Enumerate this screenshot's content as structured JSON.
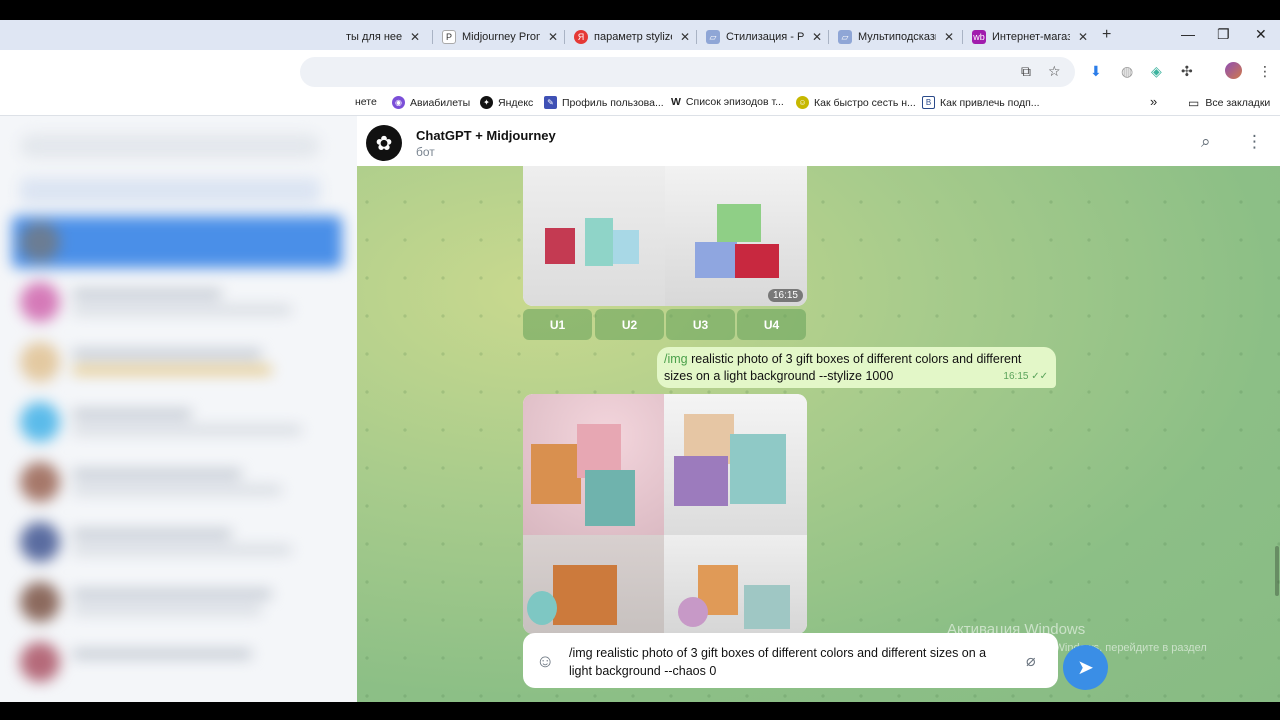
{
  "browser": {
    "tabs": [
      {
        "title": "ты для нее",
        "favicon": "chat-icon",
        "color": "#5b8fd8"
      },
      {
        "title": "Midjourney Prom",
        "favicon": "p-icon",
        "color": "#333333"
      },
      {
        "title": "параметр stylize",
        "favicon": "yandex-icon",
        "color": "#e53935"
      },
      {
        "title": "Стилизация - Ру",
        "favicon": "doc-icon",
        "color": "#6b88c4"
      },
      {
        "title": "Мультиподсказк",
        "favicon": "doc-icon",
        "color": "#6b88c4"
      },
      {
        "title": "Интернет-магаз",
        "favicon": "wb-icon",
        "color": "#a11cad"
      }
    ],
    "new_tab": "+",
    "window_controls": {
      "minimize": "—",
      "maximize": "❐",
      "close": "✕"
    },
    "bookmarks": [
      {
        "label": "нете",
        "icon": "none"
      },
      {
        "label": "Авиабилеты",
        "icon": "globe-icon",
        "color": "#7b4fd8"
      },
      {
        "label": "Яндекс",
        "icon": "yandex-icon",
        "color": "#111111"
      },
      {
        "label": "Профиль пользова...",
        "icon": "profile-icon",
        "color": "#3f51b5"
      },
      {
        "label": "Список эпизодов т...",
        "icon": "wikipedia-icon",
        "color": "#111111"
      },
      {
        "label": "Как быстро сесть н...",
        "icon": "smile-icon",
        "color": "#c6b800"
      },
      {
        "label": "Как привлечь подп...",
        "icon": "b-icon",
        "color": "#2a4a8a"
      }
    ],
    "more_bookmarks": "»",
    "all_bookmarks": "Все закладки"
  },
  "chat": {
    "bot_name": "ChatGPT + Midjourney",
    "bot_status": "бот",
    "first_image_time": "16:15",
    "upscale_buttons": [
      "U1",
      "U2",
      "U3",
      "U4"
    ],
    "outgoing": {
      "command": "/img",
      "text": " realistic photo of 3 gift boxes of different colors and different sizes on a light background --stylize 1000",
      "time": "16:15",
      "read_status": "✓✓"
    },
    "composer_text": "/img realistic photo of 3 gift boxes of different colors and different sizes on a light background --chaos 0",
    "watermark": {
      "title": "Активация Windows",
      "body": "Чтобы активировать Windows, перейдите в раздел \"Параметры\"."
    }
  },
  "colors": {
    "accent": "#3a8ee6",
    "outgoing_bubble": "#e3f7c8",
    "upscale_button": "#6fa25e"
  }
}
